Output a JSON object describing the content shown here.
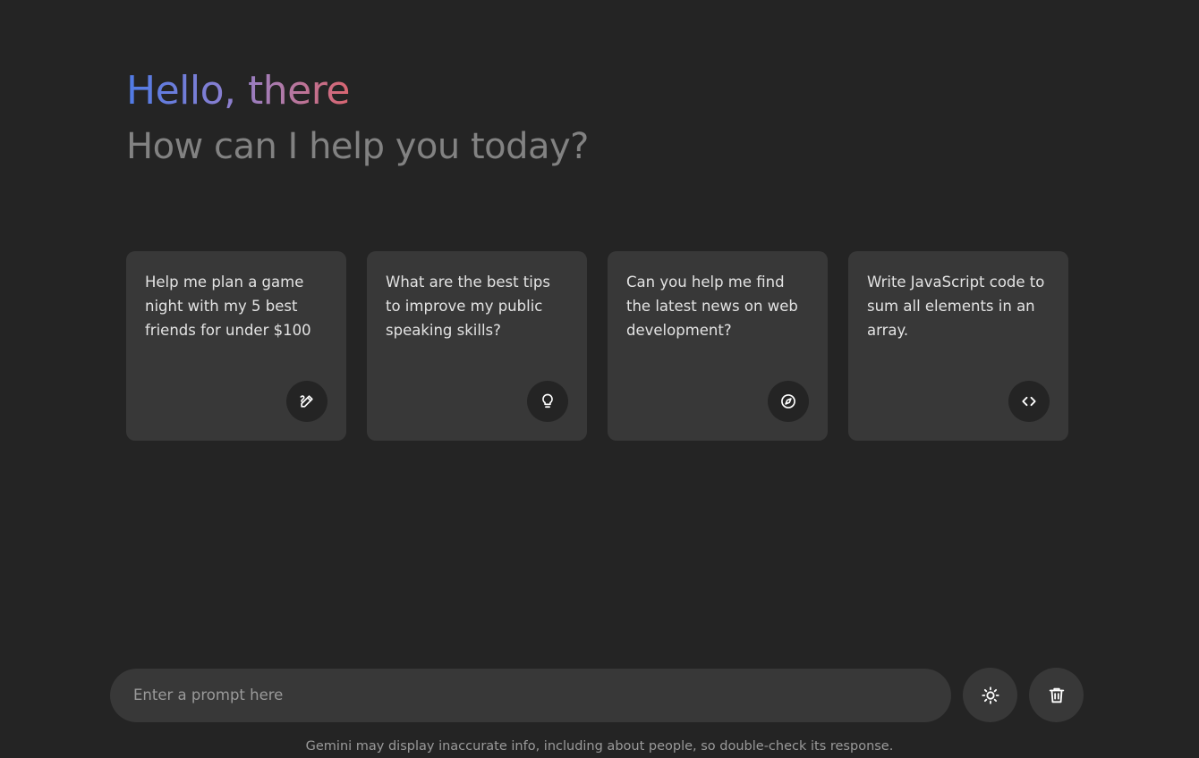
{
  "header": {
    "title": "Hello, there",
    "subtitle": "How can I help you today?"
  },
  "suggestions": [
    {
      "text": "Help me plan a game night with my 5 best friends for under $100",
      "icon": "draw-icon"
    },
    {
      "text": "What are the best tips to improve my public speaking skills?",
      "icon": "lightbulb-icon"
    },
    {
      "text": "Can you help me find the latest news on web development?",
      "icon": "explore-icon"
    },
    {
      "text": "Write JavaScript code to sum all elements in an array.",
      "icon": "code-icon"
    }
  ],
  "typing": {
    "placeholder": "Enter a prompt here",
    "value": "",
    "theme_icon": "sun-icon",
    "delete_icon": "trash-icon"
  },
  "disclaimer": "Gemini may display inaccurate info, including about people, so double-check its response.",
  "colors": {
    "background": "#242424",
    "card": "#383838",
    "gradient_start": "#4f7be6",
    "gradient_end": "#d96570",
    "subtitle": "#828282"
  }
}
